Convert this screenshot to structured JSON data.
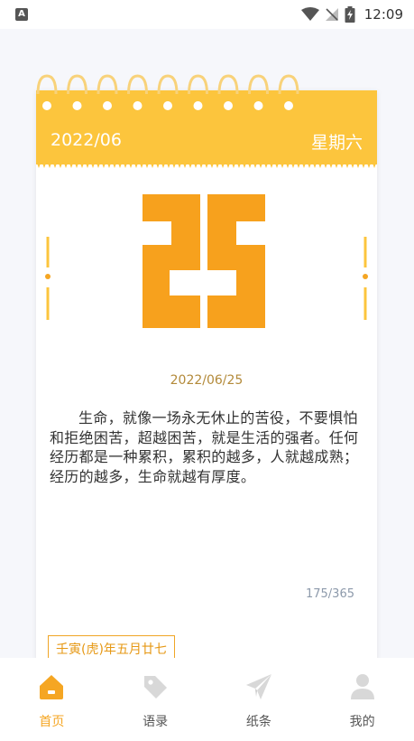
{
  "status_bar": {
    "app_icon_letter": "A",
    "time": "12:09"
  },
  "calendar": {
    "year_month": "2022/06",
    "weekday": "星期六",
    "day": "25",
    "full_date": "2022/06/25",
    "quote": "生命，就像一场永无休止的苦役，不要惧怕和拒绝困苦，超越困苦，就是生活的强者。任何经历都是一种累积，累积的越多，人就越成熟；经历的越多，生命就越有厚度。",
    "day_of_year": "175/365",
    "lunar_date": "壬寅(虎)年五月廿七"
  },
  "colors": {
    "accent": "#fcc53d",
    "day_orange": "#f7a11d",
    "nav_active": "#f5a623",
    "nav_inactive": "#d8d8d8"
  },
  "bottom_nav": {
    "items": [
      {
        "label": "首页",
        "icon": "home-icon",
        "active": true
      },
      {
        "label": "语录",
        "icon": "tag-icon",
        "active": false
      },
      {
        "label": "纸条",
        "icon": "paper-plane-icon",
        "active": false
      },
      {
        "label": "我的",
        "icon": "user-icon",
        "active": false
      }
    ]
  }
}
